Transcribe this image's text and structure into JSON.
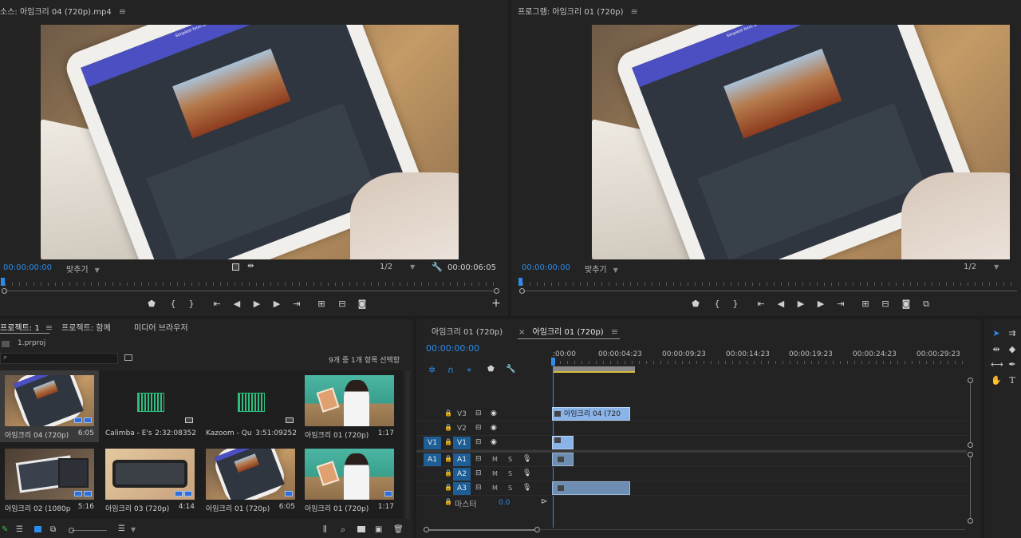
{
  "source_monitor": {
    "title": "소스: 아임크리 04 (720p).mp4",
    "menu_glyph": "≡",
    "frame_caption": "Simplest form of \"Video Editing\"",
    "timecode_in": "00:00:00:00",
    "fit_label": "맞추기",
    "resolution": "1/2",
    "timecode_duration": "00:00:06:05",
    "add_button": "+"
  },
  "program_monitor": {
    "title": "프로그램: 아임크리 01 (720p)",
    "menu_glyph": "≡",
    "timecode_in": "00:00:00:00",
    "fit_label": "맞추기",
    "resolution": "1/2"
  },
  "project_panel": {
    "tabs": [
      {
        "label": "프로젝트: 1",
        "active": true
      },
      {
        "label": "프로젝트: 함께",
        "active": false
      },
      {
        "label": "미디어 브라우저",
        "active": false
      }
    ],
    "menu_glyph": "≡",
    "file_name": "1.prproj",
    "search_placeholder": "",
    "selection_status": "9개 중 1개 항목 선택함",
    "items": [
      {
        "name": "아임크리 04 (720p)",
        "duration": "6:05",
        "kind": "video-tablet",
        "selected": true
      },
      {
        "name": "Calimba - E's",
        "duration": "2:32:08352",
        "kind": "audio"
      },
      {
        "name": "Kazoom - Qu",
        "duration": "3:51:09252",
        "kind": "audio"
      },
      {
        "name": "아임크리 01 (720p)",
        "duration": "1:17",
        "kind": "video-girl"
      },
      {
        "name": "아임크리 02 (1080p",
        "duration": "5:16",
        "kind": "video-tab2"
      },
      {
        "name": "아임크리 03 (720p)",
        "duration": "4:14",
        "kind": "video-phone"
      },
      {
        "name": "아임크리 01 (720p)",
        "duration": "6:05",
        "kind": "video-tablet"
      },
      {
        "name": "아임크리 01 (720p)",
        "duration": "1:17",
        "kind": "video-girl"
      }
    ]
  },
  "timeline": {
    "tabs": [
      {
        "label": "아임크리 01 (720p)",
        "active": false
      },
      {
        "label": "아임크리 01 (720p)",
        "active": true
      }
    ],
    "close_glyph": "×",
    "menu_glyph": "≡",
    "timecode": "00:00:00:00",
    "ruler_labels": [
      ":00:00",
      "00:00:04:23",
      "00:00:09:23",
      "00:00:14:23",
      "00:00:19:23",
      "00:00:24:23",
      "00:00:29:23"
    ],
    "tracks": [
      {
        "id": "V3",
        "type": "video",
        "target": ""
      },
      {
        "id": "V2",
        "type": "video",
        "target": ""
      },
      {
        "id": "V1",
        "type": "video",
        "target": "V1"
      },
      {
        "id": "A1",
        "type": "audio",
        "target": "A1",
        "m": "M",
        "s": "S"
      },
      {
        "id": "A2",
        "type": "audio",
        "target": "",
        "m": "M",
        "s": "S"
      },
      {
        "id": "A3",
        "type": "audio",
        "target": "",
        "m": "M",
        "s": "S"
      }
    ],
    "master_label": "마스터",
    "master_value": "0.0",
    "clip_v3_label": "아임크리 04 (720"
  }
}
